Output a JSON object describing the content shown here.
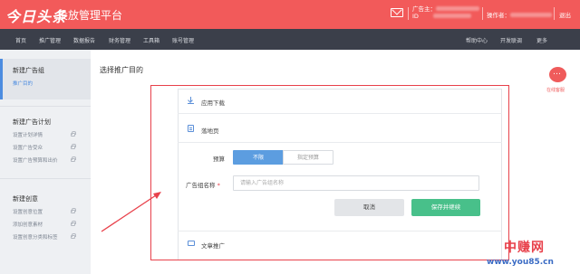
{
  "header": {
    "logo": "今日头条",
    "platform": "投放管理平台",
    "advertiser_label": "广告主：",
    "id_label": "ID",
    "operator_label": "操作者：",
    "logout": "退出"
  },
  "nav": {
    "left": [
      "首页",
      "推广管理",
      "数据报告",
      "财务管理",
      "工具箱",
      "账号管理"
    ],
    "right": [
      "帮助中心",
      "开发联调",
      "更多"
    ]
  },
  "sidebar": {
    "group1": {
      "title": "新建广告组",
      "sub": "推广目的"
    },
    "group2": {
      "title": "新建广告计划",
      "items": [
        "设置计划详情",
        "设置广告受众",
        "设置广告预算和出价"
      ]
    },
    "group3": {
      "title": "新建创意",
      "items": [
        "设置创意位置",
        "添加创意素材",
        "设置创意分类和标签"
      ]
    }
  },
  "main": {
    "title": "选择推广目的",
    "rows": {
      "app_download": "应用下载",
      "landing_page": "落地页",
      "article_promo": "文章推广"
    },
    "form": {
      "budget_label": "预算",
      "budget_options": [
        "不限",
        "指定预算"
      ],
      "group_name_label": "广告组名称",
      "required_mark": "*",
      "group_name_placeholder": "请输入广告组名称",
      "cancel": "取消",
      "save": "保存并继续"
    }
  },
  "help": {
    "label": "在线客服"
  },
  "watermark": {
    "site_name": "中赚网",
    "url": "www.you85.cn"
  },
  "colors": {
    "header": "#f25a5a",
    "nav": "#3b3f4a",
    "accent_blue": "#5c9de0",
    "save_green": "#48c08a",
    "highlight_red": "#e8414b"
  }
}
